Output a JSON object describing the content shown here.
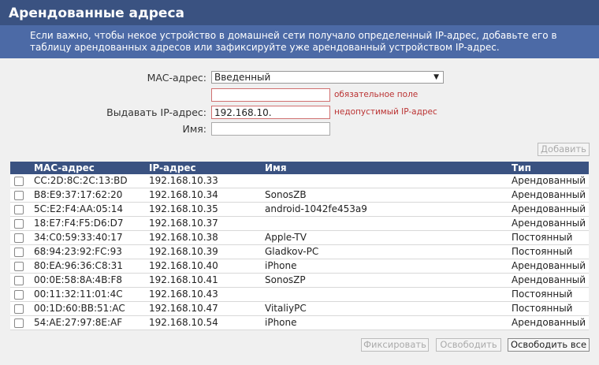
{
  "header": {
    "title": "Арендованные адреса"
  },
  "info": {
    "text": "Если важно, чтобы некое устройство в домашней сети получало определенный IP-адрес, добавьте его в таблицу арендованных адресов или зафиксируйте уже арендованный устройством IP-адрес."
  },
  "form": {
    "mac_label": "MAC-адрес:",
    "mac_mode_value": "Введенный",
    "mac_value": "",
    "mac_error": "обязательное поле",
    "ip_label": "Выдавать IP-адрес:",
    "ip_value": "192.168.10.",
    "ip_error": "недопустимый IP-адрес",
    "name_label": "Имя:",
    "name_value": "",
    "add_button": "Добавить"
  },
  "table": {
    "columns": [
      "MAC-адрес",
      "IP-адрес",
      "Имя",
      "Тип"
    ],
    "rows": [
      {
        "mac": "CC:2D:8C:2C:13:BD",
        "ip": "192.168.10.33",
        "name": "",
        "type": "Арендованный"
      },
      {
        "mac": "B8:E9:37:17:62:20",
        "ip": "192.168.10.34",
        "name": "SonosZB",
        "type": "Арендованный"
      },
      {
        "mac": "5C:E2:F4:AA:05:14",
        "ip": "192.168.10.35",
        "name": "android-1042fe453a9",
        "type": "Арендованный"
      },
      {
        "mac": "18:E7:F4:F5:D6:D7",
        "ip": "192.168.10.37",
        "name": "",
        "type": "Арендованный"
      },
      {
        "mac": "34:C0:59:33:40:17",
        "ip": "192.168.10.38",
        "name": "Apple-TV",
        "type": "Постоянный"
      },
      {
        "mac": "68:94:23:92:FC:93",
        "ip": "192.168.10.39",
        "name": "Gladkov-PC",
        "type": "Постоянный"
      },
      {
        "mac": "80:EA:96:36:C8:31",
        "ip": "192.168.10.40",
        "name": "iPhone",
        "type": "Арендованный"
      },
      {
        "mac": "00:0E:58:8A:4B:F8",
        "ip": "192.168.10.41",
        "name": "SonosZP",
        "type": "Арендованный"
      },
      {
        "mac": "00:11:32:11:01:4C",
        "ip": "192.168.10.43",
        "name": "",
        "type": "Постоянный"
      },
      {
        "mac": "00:1D:60:BB:51:AC",
        "ip": "192.168.10.47",
        "name": "VitaliyPC",
        "type": "Постоянный"
      },
      {
        "mac": "54:AE:27:97:8E:AF",
        "ip": "192.168.10.54",
        "name": "iPhone",
        "type": "Арендованный"
      }
    ]
  },
  "buttons": {
    "fix": "Фиксировать",
    "release": "Освободить",
    "release_all": "Освободить все"
  }
}
